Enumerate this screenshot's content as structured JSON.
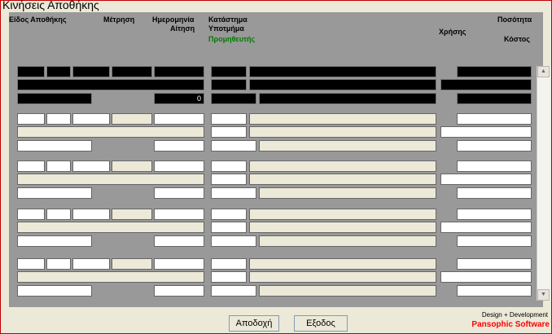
{
  "window": {
    "title": "Κινήσεις Αποθήκης"
  },
  "columns": {
    "kind": "Είδος Αποθήκης",
    "unit": "Μέτρηση",
    "date": "Ημερομηνία",
    "request": "Αίτηση",
    "status": "Κατάστημα",
    "sub": "Υποτμήμα",
    "supplier": "Προμηθευτής",
    "usage": "Χρήσης",
    "qty": "Ποσότητα",
    "cost": "Κόστος"
  },
  "records": [
    {
      "value": "0"
    }
  ],
  "buttons": {
    "accept": "Αποδοχή",
    "exit": "Εξοδος"
  },
  "credit": {
    "line1": "Design + Development",
    "line2": "Pansophic Software"
  },
  "scrollbar": {
    "up": "▲",
    "down": "▼"
  },
  "colors": {
    "frame": "#c00000",
    "grid": "#999999",
    "accent_green": "#007a00",
    "brand_red": "#ff0000"
  }
}
